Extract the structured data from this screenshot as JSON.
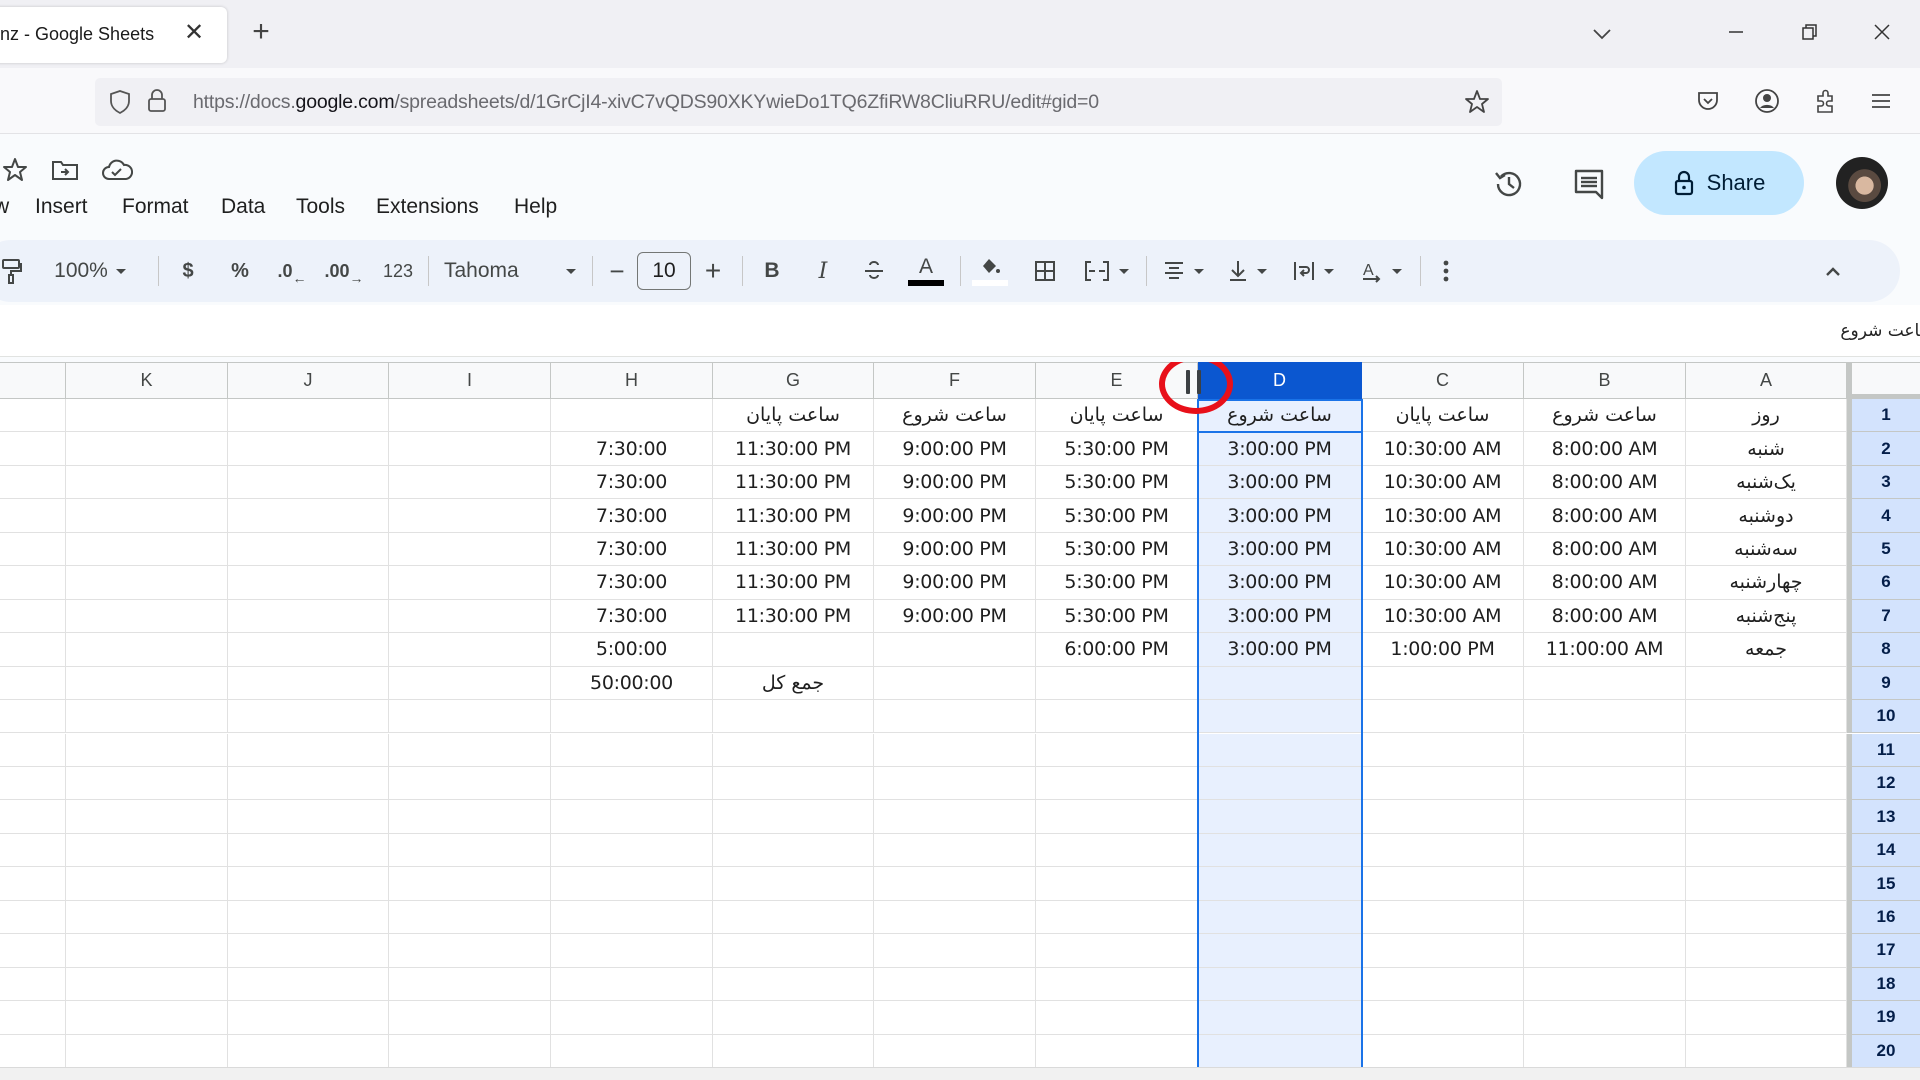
{
  "browser": {
    "tab_title": "nz - Google Sheets",
    "url_prefix": "https://docs.",
    "url_domain": "google.com",
    "url_suffix": "/spreadsheets/d/1GrCjI4-xivC7vQDS90XKYwieDo1TQ6ZfiRW8CliuRRU/edit#gid=0",
    "icons": [
      "shield-icon",
      "lock-icon",
      "bookmark-star-icon",
      "pocket-icon",
      "account-icon",
      "extensions-icon",
      "menu-icon"
    ]
  },
  "header": {
    "icons": [
      "star-icon",
      "move-to-folder-icon",
      "cloud-saved-icon"
    ],
    "menu": [
      "w",
      "Insert",
      "Format",
      "Data",
      "Tools",
      "Extensions",
      "Help"
    ],
    "share_label": "Share",
    "right_icons": [
      "version-history-icon",
      "comments-icon"
    ]
  },
  "toolbar": {
    "zoom": "100%",
    "currency": "$",
    "percent": "%",
    "decrease_decimal": ".0",
    "increase_decimal": ".00",
    "number_format": "123",
    "font": "Tahoma",
    "font_size": "10",
    "minus": "−",
    "plus": "+",
    "bold": "B",
    "italic": "I",
    "text_color": "A",
    "text_color_value": "#000000"
  },
  "formula_bar": {
    "content": "ساعت شروع"
  },
  "grid": {
    "columns": [
      "A",
      "B",
      "C",
      "D",
      "E",
      "F",
      "G",
      "H",
      "I",
      "J",
      "K",
      ""
    ],
    "selected_column": "D",
    "active_cell": "D1",
    "row_numbers": [
      "1",
      "2",
      "3",
      "4",
      "5",
      "6",
      "7",
      "8",
      "9",
      "10",
      "11",
      "12",
      "13",
      "14",
      "15",
      "16",
      "17",
      "18",
      "19",
      "20"
    ],
    "rows": [
      [
        "روز",
        "ساعت شروع",
        "ساعت پایان",
        "ساعت شروع",
        "ساعت پایان",
        "ساعت شروع",
        "ساعت پایان",
        "",
        "",
        "",
        ""
      ],
      [
        "شنبه",
        "8:00:00 AM",
        "10:30:00 AM",
        "3:00:00 PM",
        "5:30:00 PM",
        "9:00:00 PM",
        "11:30:00 PM",
        "7:30:00",
        "",
        "",
        ""
      ],
      [
        "یک‌شنبه",
        "8:00:00 AM",
        "10:30:00 AM",
        "3:00:00 PM",
        "5:30:00 PM",
        "9:00:00 PM",
        "11:30:00 PM",
        "7:30:00",
        "",
        "",
        ""
      ],
      [
        "دوشنبه",
        "8:00:00 AM",
        "10:30:00 AM",
        "3:00:00 PM",
        "5:30:00 PM",
        "9:00:00 PM",
        "11:30:00 PM",
        "7:30:00",
        "",
        "",
        ""
      ],
      [
        "سه‌شنبه",
        "8:00:00 AM",
        "10:30:00 AM",
        "3:00:00 PM",
        "5:30:00 PM",
        "9:00:00 PM",
        "11:30:00 PM",
        "7:30:00",
        "",
        "",
        ""
      ],
      [
        "چهارشنبه",
        "8:00:00 AM",
        "10:30:00 AM",
        "3:00:00 PM",
        "5:30:00 PM",
        "9:00:00 PM",
        "11:30:00 PM",
        "7:30:00",
        "",
        "",
        ""
      ],
      [
        "پنج‌شنبه",
        "8:00:00 AM",
        "10:30:00 AM",
        "3:00:00 PM",
        "5:30:00 PM",
        "9:00:00 PM",
        "11:30:00 PM",
        "7:30:00",
        "",
        "",
        ""
      ],
      [
        "جمعه",
        "11:00:00 AM",
        "1:00:00 PM",
        "3:00:00 PM",
        "6:00:00 PM",
        "",
        "",
        "5:00:00",
        "",
        "",
        ""
      ],
      [
        "",
        "",
        "",
        "",
        "",
        "",
        "جمع کل",
        "50:00:00",
        "",
        "",
        ""
      ]
    ]
  },
  "colors": {
    "accent": "#0b57d0",
    "selection_fill": "#e8f0fe",
    "share_bg": "#c2e7ff",
    "annotation": "#e8101a"
  }
}
